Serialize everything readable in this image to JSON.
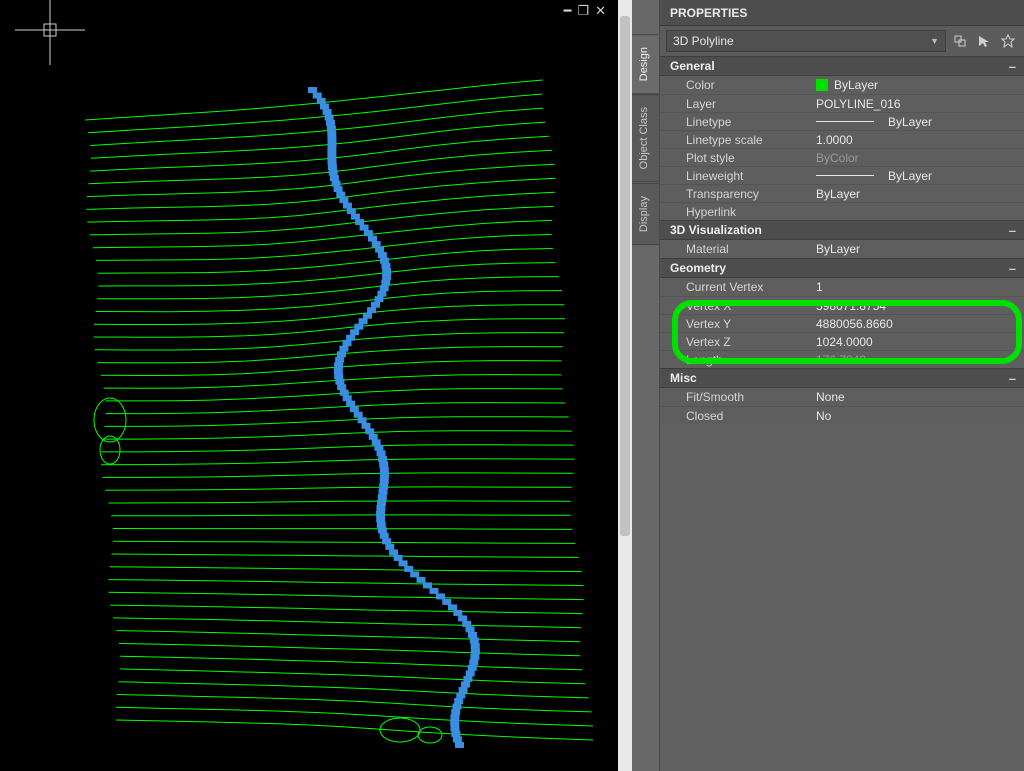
{
  "panel": {
    "title": "PROPERTIES",
    "object_type": "3D Polyline",
    "tabs": [
      "Design",
      "Object Class",
      "Display"
    ]
  },
  "toolbar": {
    "quick_select": "quick-select",
    "pick_object": "pick-object",
    "quick_calc": "quick-calc"
  },
  "general": {
    "header": "General",
    "color_label": "Color",
    "color_value": "ByLayer",
    "layer_label": "Layer",
    "layer_value": "POLYLINE_016",
    "linetype_label": "Linetype",
    "linetype_value": "ByLayer",
    "ltscale_label": "Linetype scale",
    "ltscale_value": "1.0000",
    "plotstyle_label": "Plot style",
    "plotstyle_value": "ByColor",
    "lineweight_label": "Lineweight",
    "lineweight_value": "ByLayer",
    "transparency_label": "Transparency",
    "transparency_value": "ByLayer",
    "hyperlink_label": "Hyperlink",
    "hyperlink_value": ""
  },
  "viz": {
    "header": "3D Visualization",
    "material_label": "Material",
    "material_value": "ByLayer"
  },
  "geometry": {
    "header": "Geometry",
    "current_vertex_label": "Current Vertex",
    "current_vertex_value": "1",
    "vertex_x_label": "Vertex X",
    "vertex_x_value": "598071.8754",
    "vertex_y_label": "Vertex Y",
    "vertex_y_value": "4880056.8660",
    "vertex_z_label": "Vertex Z",
    "vertex_z_value": "1024.0000",
    "length_label": "Length",
    "length_value": "176.7842"
  },
  "misc": {
    "header": "Misc",
    "fit_label": "Fit/Smooth",
    "fit_value": "None",
    "closed_label": "Closed",
    "closed_value": "No"
  },
  "viewport": {
    "contour_color": "#00ff00",
    "selection_color": "#3a8ee0",
    "n_contours": 48
  }
}
